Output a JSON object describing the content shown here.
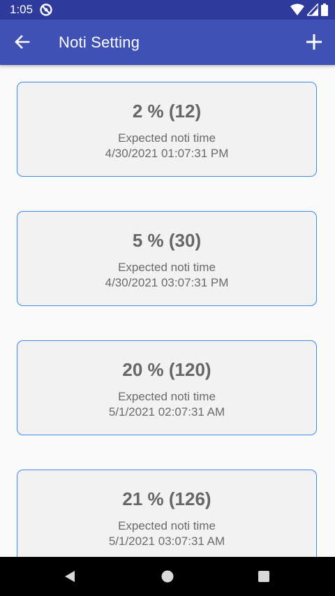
{
  "status_bar": {
    "time": "1:05",
    "icons": [
      "app-notification-icon",
      "wifi-icon",
      "signal-icon",
      "battery-icon"
    ]
  },
  "app_bar": {
    "title": "Noti Setting",
    "back_icon": "arrow-back-icon",
    "add_icon": "plus-icon"
  },
  "cards": [
    {
      "title": "2 % (12)",
      "label": "Expected noti time",
      "time": "4/30/2021 01:07:31 PM"
    },
    {
      "title": "5 % (30)",
      "label": "Expected noti time",
      "time": "4/30/2021 03:07:31 PM"
    },
    {
      "title": "20 % (120)",
      "label": "Expected noti time",
      "time": "5/1/2021 02:07:31 AM"
    },
    {
      "title": "21 % (126)",
      "label": "Expected noti time",
      "time": "5/1/2021 03:07:31 AM"
    }
  ],
  "colors": {
    "status_bar": "#2f3b9c",
    "app_bar": "#3f51b5",
    "card_border": "#3d8bea",
    "card_bg": "#f2f2f2",
    "text_gray": "#666666"
  },
  "nav": {
    "icons": [
      "nav-back-icon",
      "nav-home-icon",
      "nav-recents-icon"
    ]
  }
}
